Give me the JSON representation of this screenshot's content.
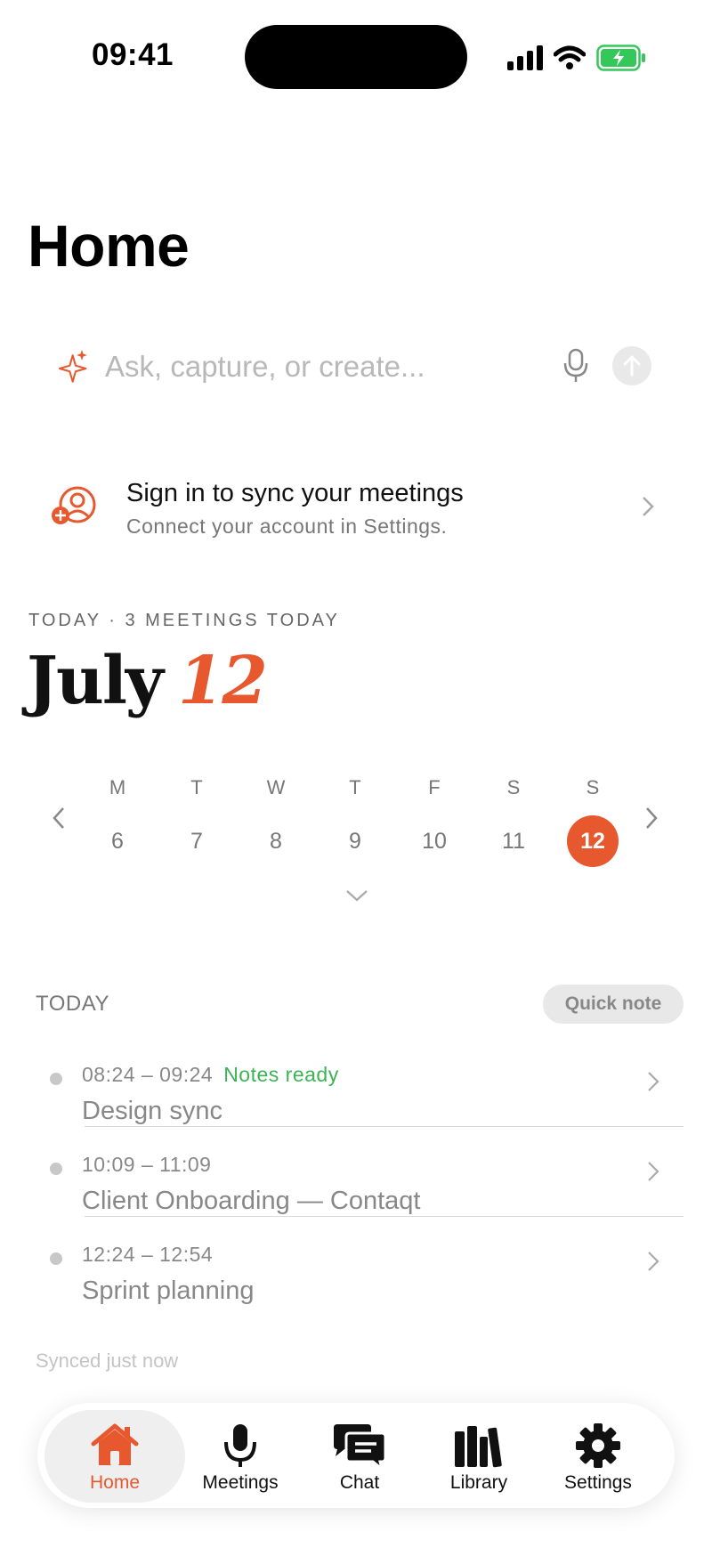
{
  "status_bar": {
    "time": "09:41"
  },
  "page": {
    "title": "Home"
  },
  "search": {
    "placeholder": "Ask, capture, or create..."
  },
  "signin": {
    "title": "Sign in to sync your meetings",
    "subtitle": "Connect your account in Settings."
  },
  "date_header": {
    "caption": "TODAY · 3 MEETINGS TODAY",
    "month": "July",
    "day": "12"
  },
  "week": {
    "days": [
      {
        "letter": "M",
        "num": "6"
      },
      {
        "letter": "T",
        "num": "7"
      },
      {
        "letter": "W",
        "num": "8"
      },
      {
        "letter": "T",
        "num": "9"
      },
      {
        "letter": "F",
        "num": "10"
      },
      {
        "letter": "S",
        "num": "11"
      },
      {
        "letter": "S",
        "num": "12"
      }
    ],
    "selected_index": 6
  },
  "today_list": {
    "caption": "TODAY",
    "quick_note_label": "Quick note",
    "meetings": [
      {
        "time": "08:24 – 09:24",
        "status": "Notes ready",
        "name": "Design sync"
      },
      {
        "time": "10:09 – 11:09",
        "status": "",
        "name": "Client Onboarding — Contaqt"
      },
      {
        "time": "12:24 – 12:54",
        "status": "",
        "name": "Sprint planning"
      }
    ],
    "sync_status": "Synced just now"
  },
  "nav": {
    "items": [
      {
        "label": "Home",
        "icon": "home-icon"
      },
      {
        "label": "Meetings",
        "icon": "microphone-icon"
      },
      {
        "label": "Chat",
        "icon": "chat-icon"
      },
      {
        "label": "Library",
        "icon": "library-icon"
      },
      {
        "label": "Settings",
        "icon": "gear-icon"
      }
    ],
    "active": "Home"
  },
  "colors": {
    "accent": "#e8582f",
    "notes_ready": "#3cb454",
    "battery": "#34c759"
  }
}
